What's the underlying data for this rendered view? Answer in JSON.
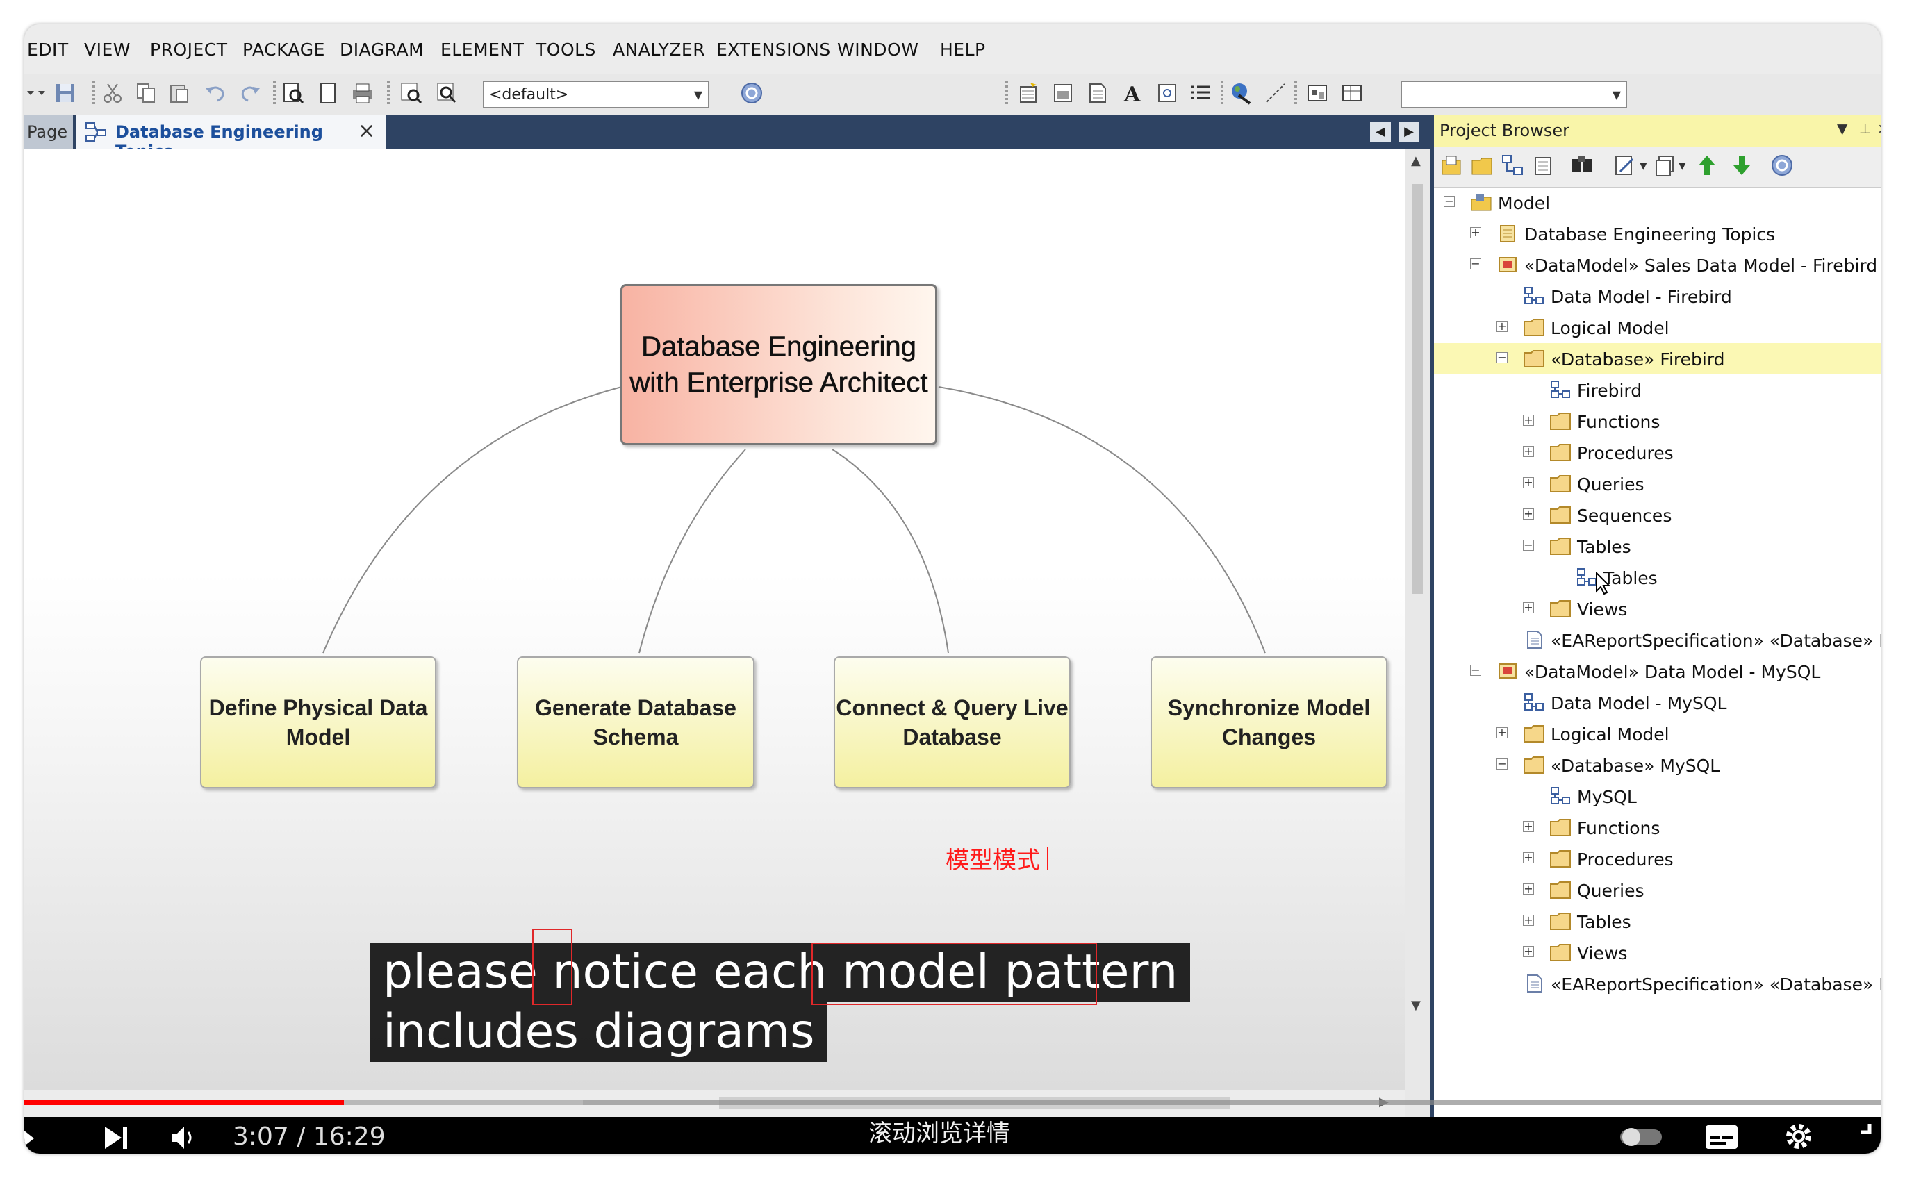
{
  "menu": [
    "EDIT",
    "VIEW",
    "PROJECT",
    "PACKAGE",
    "DIAGRAM",
    "ELEMENT",
    "TOOLS",
    "ANALYZER",
    "EXTENSIONS",
    "WINDOW",
    "HELP"
  ],
  "toolbar": {
    "layout_combo": "<default>",
    "right_combo": ""
  },
  "tabs": {
    "prev_label": "Page",
    "active_label": "Database Engineering Topics"
  },
  "diagram": {
    "root": "Database Engineering with Enterprise Architect",
    "children": [
      "Define Physical Data Model",
      "Generate Database Schema",
      "Connect & Query Live Database",
      "Synchronize Model Changes"
    ]
  },
  "overlay": {
    "chinese_note": "模型模式",
    "caption_line1": "please notice each model pattern",
    "caption_line2": "includes diagrams"
  },
  "project_browser": {
    "title": "Project Browser",
    "tree": [
      {
        "label": "Model",
        "icon": "model-root-icon",
        "expander": "minus"
      },
      {
        "label": "Database Engineering Topics",
        "icon": "package-icon",
        "expander": "plus"
      },
      {
        "label": "«DataModel» Sales Data Model - Firebird",
        "icon": "datamodel-package-icon",
        "expander": "minus"
      },
      {
        "label": "Data Model - Firebird",
        "icon": "diagram-icon",
        "expander": ""
      },
      {
        "label": "Logical Model",
        "icon": "folder-icon",
        "expander": "plus"
      },
      {
        "label": "«Database» Firebird",
        "icon": "folder-icon",
        "expander": "minus"
      },
      {
        "label": "Firebird",
        "icon": "diagram-icon",
        "expander": ""
      },
      {
        "label": "Functions",
        "icon": "folder-icon",
        "expander": "plus"
      },
      {
        "label": "Procedures",
        "icon": "folder-icon",
        "expander": "plus"
      },
      {
        "label": "Queries",
        "icon": "folder-icon",
        "expander": "plus"
      },
      {
        "label": "Sequences",
        "icon": "folder-icon",
        "expander": "plus"
      },
      {
        "label": "Tables",
        "icon": "folder-icon",
        "expander": "minus"
      },
      {
        "label": "Tables",
        "icon": "diagram-icon",
        "expander": ""
      },
      {
        "label": "Views",
        "icon": "folder-icon",
        "expander": "plus"
      },
      {
        "label": "«EAReportSpecification» «Database» Fi",
        "icon": "document-icon",
        "expander": ""
      },
      {
        "label": "«DataModel» Data Model - MySQL",
        "icon": "datamodel-package-icon",
        "expander": "minus"
      },
      {
        "label": "Data Model - MySQL",
        "icon": "diagram-icon",
        "expander": ""
      },
      {
        "label": "Logical Model",
        "icon": "folder-icon",
        "expander": "plus"
      },
      {
        "label": "«Database» MySQL",
        "icon": "folder-icon",
        "expander": "minus"
      },
      {
        "label": "MySQL",
        "icon": "diagram-icon",
        "expander": ""
      },
      {
        "label": "Functions",
        "icon": "folder-icon",
        "expander": "plus"
      },
      {
        "label": "Procedures",
        "icon": "folder-icon",
        "expander": "plus"
      },
      {
        "label": "Queries",
        "icon": "folder-icon",
        "expander": "plus"
      },
      {
        "label": "Tables",
        "icon": "folder-icon",
        "expander": "plus"
      },
      {
        "label": "Views",
        "icon": "folder-icon",
        "expander": "plus"
      },
      {
        "label": "«EAReportSpecification» «Database» M",
        "icon": "document-icon",
        "expander": ""
      }
    ]
  },
  "player": {
    "time": "3:07 / 16:29",
    "hint": "滚动浏览详情",
    "progress_played": 0.172,
    "progress_buffered": 0.301
  },
  "colors": {
    "tab_bar": "#2e4363",
    "node_fill": "#f4f0a0",
    "root_fill": "#f8b3a3",
    "accent_red": "#ff0000",
    "selected_row": "#fbf8b4"
  }
}
